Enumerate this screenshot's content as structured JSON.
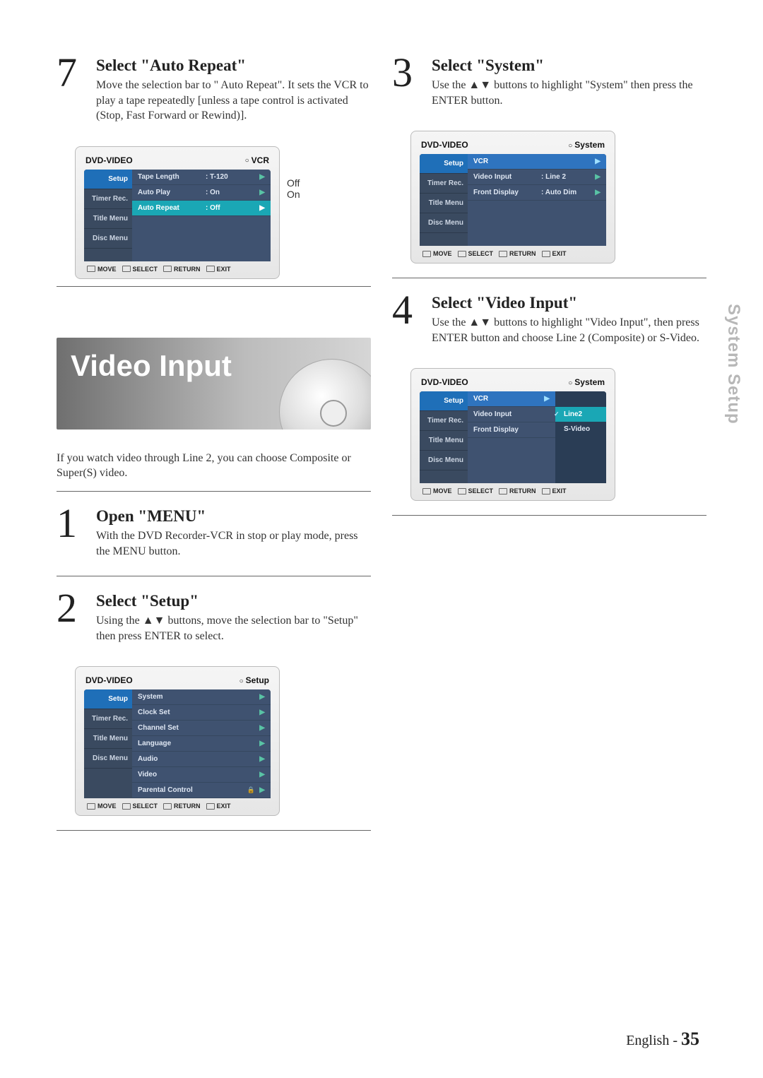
{
  "gutter_label": "System Setup",
  "footer": {
    "lang": "English - ",
    "page": "35"
  },
  "step7": {
    "num": "7",
    "title": "Select \"Auto Repeat\"",
    "desc": "Move the selection bar to \" Auto Repeat\". It sets the VCR to play a tape repeatedly [unless a tape control is activated (Stop, Fast Forward or Rewind)].",
    "callout_off": "Off",
    "callout_on": "On"
  },
  "osd7": {
    "brand": "DVD-VIDEO",
    "crumb": "VCR",
    "side": [
      "Setup",
      "Timer Rec.",
      "Title Menu",
      "Disc Menu"
    ],
    "rows": [
      {
        "lbl": "Tape Length",
        "val": ": T-120",
        "sel": false
      },
      {
        "lbl": "Auto Play",
        "val": ": On",
        "sel": false
      },
      {
        "lbl": "Auto Repeat",
        "val": ": Off",
        "sel": true
      }
    ],
    "foot": {
      "move": "MOVE",
      "select": "SELECT",
      "ret": "RETURN",
      "exit": "EXIT"
    }
  },
  "hero": {
    "title": "Video Input",
    "caption": "If you watch video through Line 2, you can choose Composite or Super(S) video."
  },
  "step1": {
    "num": "1",
    "title": "Open \"MENU\"",
    "desc": "With the DVD Recorder-VCR in stop or play mode, press the MENU button."
  },
  "step2": {
    "num": "2",
    "title": "Select \"Setup\"",
    "desc": "Using the ▲▼ buttons, move the selection bar to \"Setup\" then press ENTER to select."
  },
  "osd2": {
    "brand": "DVD-VIDEO",
    "crumb": "Setup",
    "side": [
      "Setup",
      "Timer Rec.",
      "Title Menu",
      "Disc Menu"
    ],
    "rows": [
      {
        "lbl": "System",
        "val": "",
        "sel": false
      },
      {
        "lbl": "Clock Set",
        "val": "",
        "sel": false
      },
      {
        "lbl": "Channel Set",
        "val": "",
        "sel": false
      },
      {
        "lbl": "Language",
        "val": "",
        "sel": false
      },
      {
        "lbl": "Audio",
        "val": "",
        "sel": false
      },
      {
        "lbl": "Video",
        "val": "",
        "sel": false
      },
      {
        "lbl": "Parental Control",
        "val": "",
        "sel": false,
        "lock": true
      }
    ],
    "foot": {
      "move": "MOVE",
      "select": "SELECT",
      "ret": "RETURN",
      "exit": "EXIT"
    }
  },
  "step3": {
    "num": "3",
    "title": "Select \"System\"",
    "desc": "Use the ▲▼ buttons to highlight \"System\" then press the ENTER button."
  },
  "osd3": {
    "brand": "DVD-VIDEO",
    "crumb": "System",
    "side": [
      "Setup",
      "Timer Rec.",
      "Title Menu",
      "Disc Menu"
    ],
    "hdr": "VCR",
    "rows": [
      {
        "lbl": "Video Input",
        "val": ": Line 2",
        "sel": false
      },
      {
        "lbl": "Front Display",
        "val": ": Auto Dim",
        "sel": false
      }
    ],
    "foot": {
      "move": "MOVE",
      "select": "SELECT",
      "ret": "RETURN",
      "exit": "EXIT"
    }
  },
  "step4": {
    "num": "4",
    "title": "Select \"Video Input\"",
    "desc": "Use the ▲▼ buttons to highlight \"Video Input\", then press ENTER button and choose Line 2 (Composite) or S-Video."
  },
  "osd4": {
    "brand": "DVD-VIDEO",
    "crumb": "System",
    "side": [
      "Setup",
      "Timer Rec.",
      "Title Menu",
      "Disc Menu"
    ],
    "hdr": "VCR",
    "rows": [
      {
        "lbl": "Video Input",
        "val": "",
        "sel": false
      },
      {
        "lbl": "Front Display",
        "val": "",
        "sel": false
      }
    ],
    "popup": [
      {
        "lbl": "Line2",
        "checked": true,
        "sel": true
      },
      {
        "lbl": "S-Video",
        "checked": false,
        "sel": false
      }
    ],
    "foot": {
      "move": "MOVE",
      "select": "SELECT",
      "ret": "RETURN",
      "exit": "EXIT"
    }
  }
}
